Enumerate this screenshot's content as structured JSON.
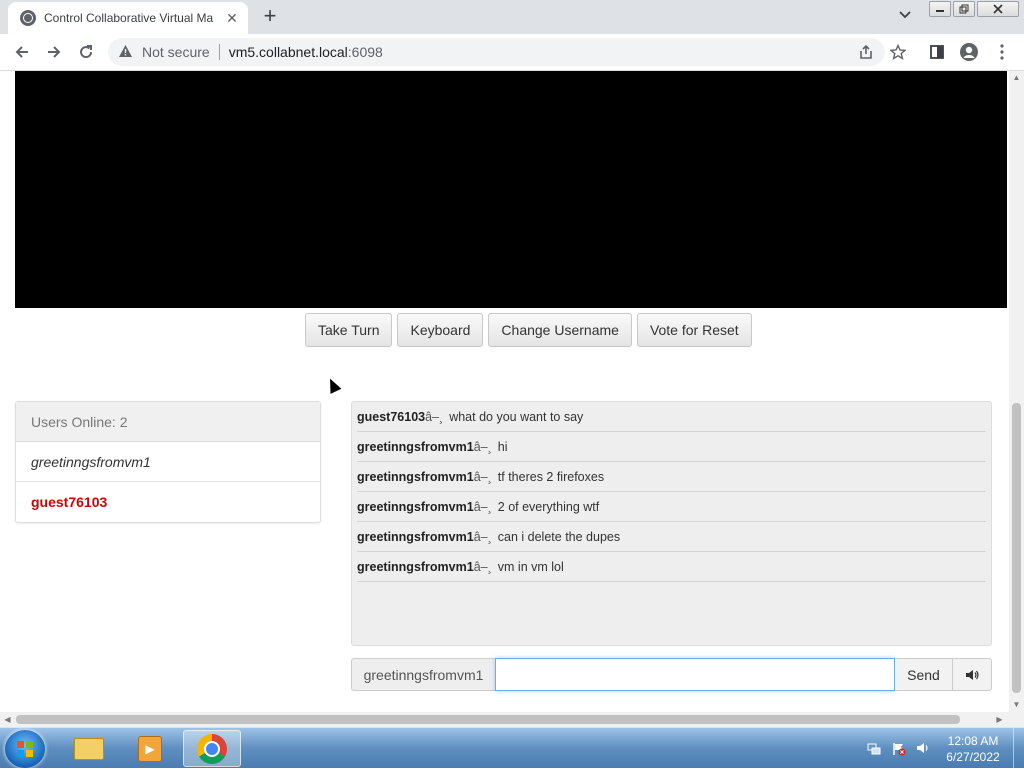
{
  "browser": {
    "tab_title": "Control Collaborative Virtual Ma",
    "tab_close": "✕",
    "new_tab": "+",
    "security_label": "Not secure",
    "url_host": "vm5.collabnet.local",
    "url_port": ":6098"
  },
  "page": {
    "controls": [
      "Take Turn",
      "Keyboard",
      "Change Username",
      "Vote for Reset"
    ],
    "users": {
      "heading": "Users Online: 2",
      "list": [
        "greetinngsfromvm1",
        "guest76103"
      ]
    },
    "chat": {
      "messages": [
        {
          "user": "guest76103",
          "sep": "â–¸",
          "text": "what do you want to say"
        },
        {
          "user": "greetinngsfromvm1",
          "sep": "â–¸",
          "text": "hi"
        },
        {
          "user": "greetinngsfromvm1",
          "sep": "â–¸",
          "text": "tf theres 2 firefoxes"
        },
        {
          "user": "greetinngsfromvm1",
          "sep": "â–¸",
          "text": "2 of everything wtf"
        },
        {
          "user": "greetinngsfromvm1",
          "sep": "â–¸",
          "text": "can i delete the dupes"
        },
        {
          "user": "greetinngsfromvm1",
          "sep": "â–¸",
          "text": "vm in vm lol"
        }
      ],
      "username_addon": "greetinngsfromvm1",
      "input_value": "",
      "send_label": "Send",
      "sound_icon": "🔊"
    }
  },
  "taskbar": {
    "time": "12:08 AM",
    "date": "6/27/2022"
  }
}
